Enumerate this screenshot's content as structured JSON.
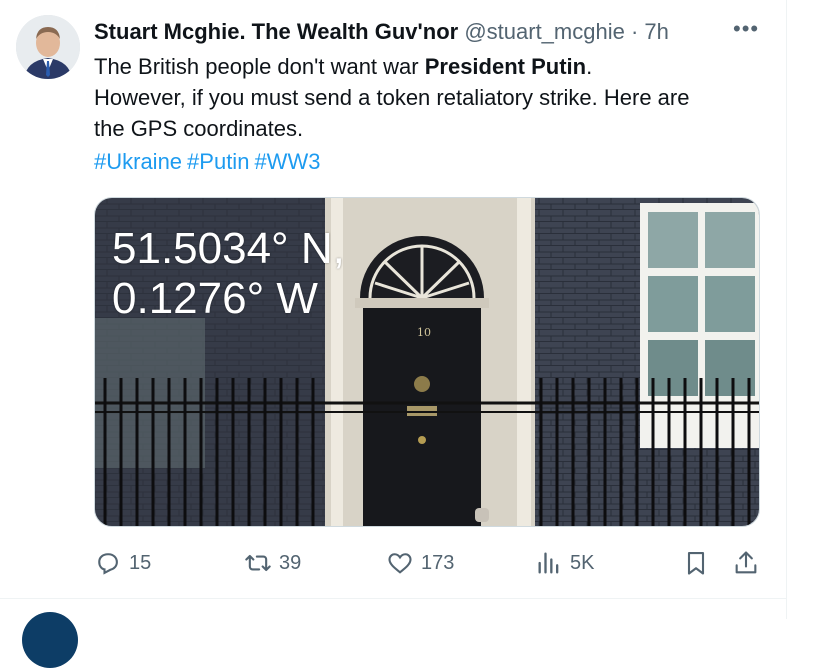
{
  "tweet": {
    "author_name": "Stuart Mcghie. The Wealth Guv'nor",
    "handle": "@stuart_mcghie",
    "separator": "·",
    "time": "7h",
    "more_label": "•••",
    "text_line1_a": "The British people don't want war ",
    "text_line1_bold": "President Putin",
    "text_line1_b": ".",
    "text_line2": "However, if you must send a token retaliatory strike. Here are",
    "text_line3": "the GPS coordinates.",
    "hashtags": [
      "#Ukraine",
      "#Putin",
      "#WW3"
    ],
    "image": {
      "coord_line1": "51.5034° N,",
      "coord_line2": "0.1276° W",
      "door_number": "10"
    },
    "actions": {
      "replies": "15",
      "retweets": "39",
      "likes": "173",
      "views": "5K"
    }
  },
  "colors": {
    "link": "#1d9bf0",
    "muted": "#536471",
    "text": "#0f1419"
  },
  "icons": [
    "reply-icon",
    "retweet-icon",
    "like-icon",
    "views-icon",
    "bookmark-icon",
    "share-icon"
  ]
}
